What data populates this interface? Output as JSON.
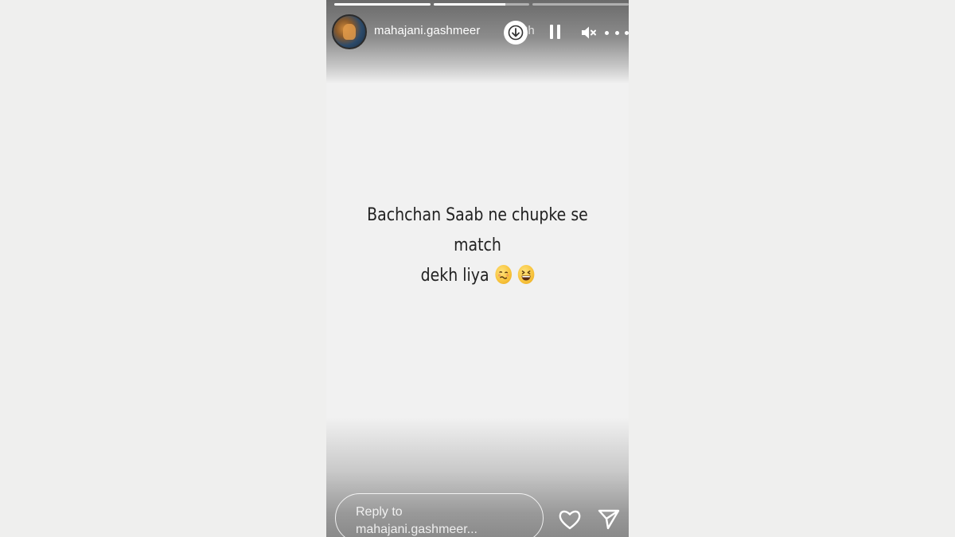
{
  "story": {
    "progress": [
      1.0,
      0.75,
      0.0
    ],
    "username": "mahajani.gashmeer",
    "time_ago": "3h",
    "caption_line1": "Bachchan Saab ne chupke se match",
    "caption_line2": "dekh liya",
    "caption_emojis": [
      "woozy-face",
      "grinning-squinting-face"
    ],
    "reply_placeholder": "Reply to mahajani.gashmeer..."
  },
  "icons": {
    "download": "download-icon",
    "pause": "pause-icon",
    "mute": "mute-icon",
    "more": "more-icon",
    "heart": "heart-icon",
    "send": "send-icon"
  },
  "colors": {
    "background": "#efefee",
    "story_background": "#f1f1f1",
    "caption_text": "#222222",
    "overlay_text": "#ffffff"
  }
}
